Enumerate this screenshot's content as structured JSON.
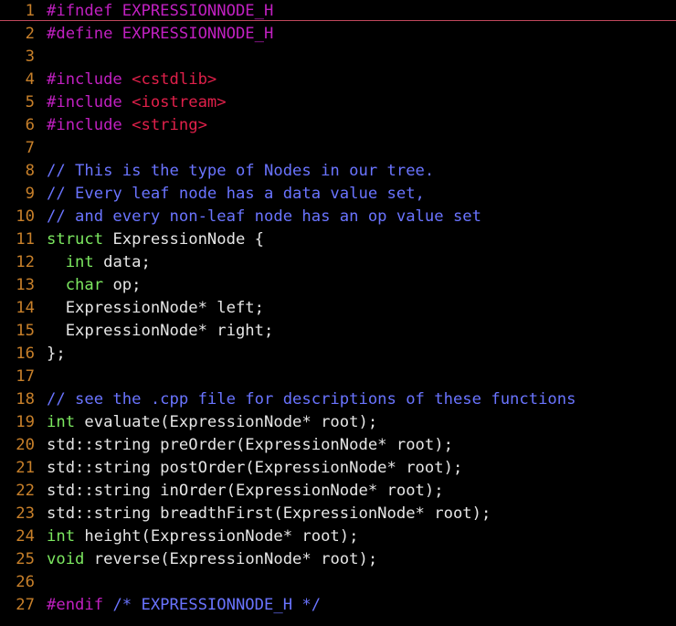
{
  "colors": {
    "background": "#000000",
    "line_number": "#c8802a",
    "preprocessor": "#c020c0",
    "header_string": "#e0204a",
    "comment": "#6a74ff",
    "type_keyword": "#7ce860",
    "plain": "#e6e6e6",
    "cursor_line": "#c0485c"
  },
  "editor": {
    "current_line": 1,
    "lines": [
      {
        "num": "1",
        "tokens": [
          {
            "t": "#ifndef EXPRESSIONNODE_H",
            "c": "preproc"
          }
        ]
      },
      {
        "num": "2",
        "tokens": [
          {
            "t": "#define EXPRESSIONNODE_H",
            "c": "preproc"
          }
        ]
      },
      {
        "num": "3",
        "tokens": []
      },
      {
        "num": "4",
        "tokens": [
          {
            "t": "#include ",
            "c": "preproc"
          },
          {
            "t": "<cstdlib>",
            "c": "header"
          }
        ]
      },
      {
        "num": "5",
        "tokens": [
          {
            "t": "#include ",
            "c": "preproc"
          },
          {
            "t": "<iostream>",
            "c": "header"
          }
        ]
      },
      {
        "num": "6",
        "tokens": [
          {
            "t": "#include ",
            "c": "preproc"
          },
          {
            "t": "<string>",
            "c": "header"
          }
        ]
      },
      {
        "num": "7",
        "tokens": []
      },
      {
        "num": "8",
        "tokens": [
          {
            "t": "// This is the type of Nodes in our tree.",
            "c": "comment"
          }
        ]
      },
      {
        "num": "9",
        "tokens": [
          {
            "t": "// Every leaf node has a data value set,",
            "c": "comment"
          }
        ]
      },
      {
        "num": "10",
        "tokens": [
          {
            "t": "// and every non-leaf node has an op value set",
            "c": "comment"
          }
        ]
      },
      {
        "num": "11",
        "tokens": [
          {
            "t": "struct",
            "c": "type"
          },
          {
            "t": " ExpressionNode {",
            "c": "plain"
          }
        ]
      },
      {
        "num": "12",
        "tokens": [
          {
            "t": "  ",
            "c": "plain"
          },
          {
            "t": "int",
            "c": "type"
          },
          {
            "t": " data;",
            "c": "plain"
          }
        ]
      },
      {
        "num": "13",
        "tokens": [
          {
            "t": "  ",
            "c": "plain"
          },
          {
            "t": "char",
            "c": "type"
          },
          {
            "t": " op;",
            "c": "plain"
          }
        ]
      },
      {
        "num": "14",
        "tokens": [
          {
            "t": "  ExpressionNode* left;",
            "c": "plain"
          }
        ]
      },
      {
        "num": "15",
        "tokens": [
          {
            "t": "  ExpressionNode* right;",
            "c": "plain"
          }
        ]
      },
      {
        "num": "16",
        "tokens": [
          {
            "t": "};",
            "c": "plain"
          }
        ]
      },
      {
        "num": "17",
        "tokens": []
      },
      {
        "num": "18",
        "tokens": [
          {
            "t": "// see the .cpp file for descriptions of these functions",
            "c": "comment"
          }
        ]
      },
      {
        "num": "19",
        "tokens": [
          {
            "t": "int",
            "c": "type"
          },
          {
            "t": " evaluate(ExpressionNode* root);",
            "c": "plain"
          }
        ]
      },
      {
        "num": "20",
        "tokens": [
          {
            "t": "std::string preOrder(ExpressionNode* root);",
            "c": "plain"
          }
        ]
      },
      {
        "num": "21",
        "tokens": [
          {
            "t": "std::string postOrder(ExpressionNode* root);",
            "c": "plain"
          }
        ]
      },
      {
        "num": "22",
        "tokens": [
          {
            "t": "std::string inOrder(ExpressionNode* root);",
            "c": "plain"
          }
        ]
      },
      {
        "num": "23",
        "tokens": [
          {
            "t": "std::string breadthFirst(ExpressionNode* root);",
            "c": "plain"
          }
        ]
      },
      {
        "num": "24",
        "tokens": [
          {
            "t": "int",
            "c": "type"
          },
          {
            "t": " height(ExpressionNode* root);",
            "c": "plain"
          }
        ]
      },
      {
        "num": "25",
        "tokens": [
          {
            "t": "void",
            "c": "type"
          },
          {
            "t": " reverse(ExpressionNode* root);",
            "c": "plain"
          }
        ]
      },
      {
        "num": "26",
        "tokens": []
      },
      {
        "num": "27",
        "tokens": [
          {
            "t": "#endif ",
            "c": "preproc"
          },
          {
            "t": "/* EXPRESSIONNODE_H */",
            "c": "comment"
          }
        ]
      }
    ]
  }
}
